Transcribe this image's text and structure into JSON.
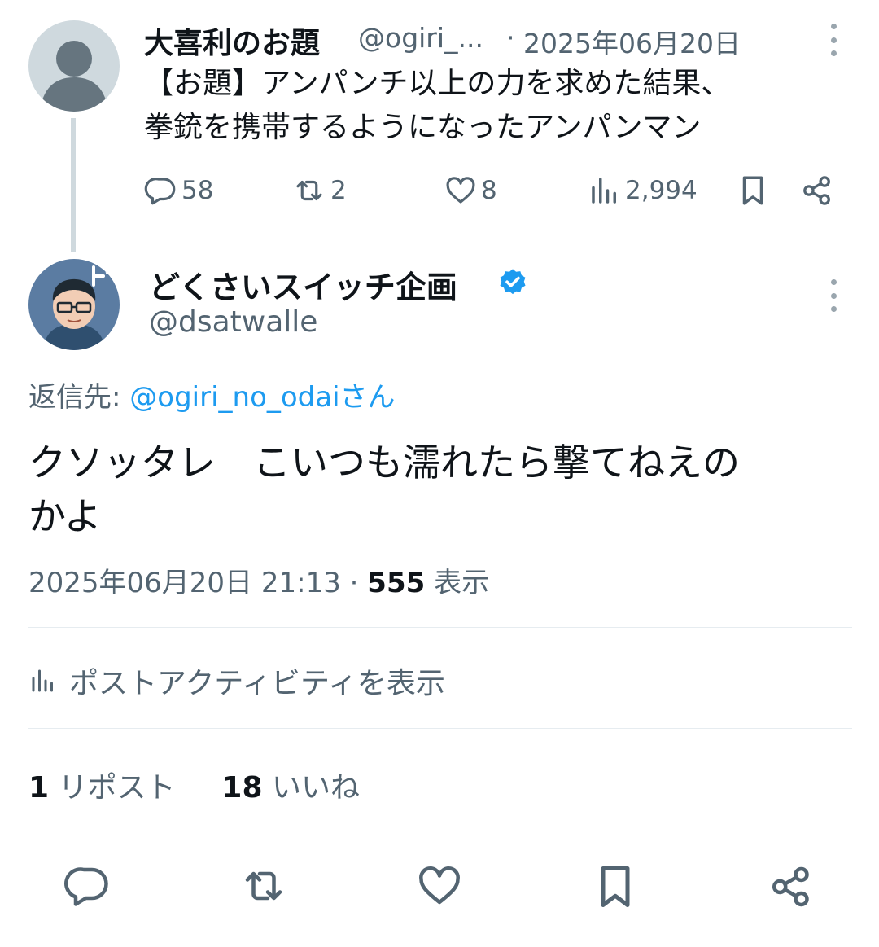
{
  "parent_tweet": {
    "display_name": "大喜利のお題",
    "handle": "@ogiri_...",
    "separator": "·",
    "date": "2025年06月20日",
    "text_line1": "【お題】アンパンチ以上の力を求めた結果、",
    "text_line2": "拳銃を携帯するようになったアンパンマン",
    "replies": "58",
    "reposts": "2",
    "likes": "8",
    "views": "2,994",
    "icons": [
      "reply-icon",
      "repost-icon",
      "like-icon",
      "views-icon",
      "bookmark-icon",
      "share-icon",
      "more-icon"
    ]
  },
  "main_tweet": {
    "display_name": "どくさいスイッチ企画",
    "handle": "@dsatwalle",
    "reply_prefix": "返信先: ",
    "reply_target": "@ogiri_no_odaiさん",
    "text_line1": "クソッタレ　こいつも濡れたら撃てねえの",
    "text_line2": "かよ",
    "timestamp": "2025年06月20日 21:13",
    "meta_separator": " · ",
    "view_count": "555",
    "view_label": " 表示",
    "activity_link": "ポストアクティビティを表示",
    "repost_count": "1",
    "repost_label": " リポスト",
    "like_count": "18",
    "like_label": " いいね"
  },
  "colors": {
    "accent": "#1d9bf0",
    "text": "#0f1419",
    "secondary": "#536471",
    "placeholder_avatar": "#cfd9de",
    "divider": "#e6ecf0"
  }
}
